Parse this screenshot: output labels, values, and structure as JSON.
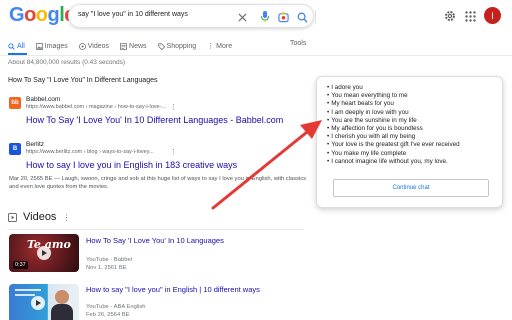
{
  "header": {
    "logo_letters": [
      {
        "char": "G",
        "color": "#4285F4"
      },
      {
        "char": "o",
        "color": "#EA4335"
      },
      {
        "char": "o",
        "color": "#FBBC05"
      },
      {
        "char": "g",
        "color": "#4285F4"
      },
      {
        "char": "l",
        "color": "#34A853"
      },
      {
        "char": "e",
        "color": "#EA4335"
      }
    ],
    "search_value": "say \"I love you\" in 10 different ways",
    "avatar_letter": "I",
    "icons": [
      "close-icon",
      "mic-icon",
      "lens-icon",
      "search-icon",
      "settings-icon",
      "apps-icon"
    ]
  },
  "tabs": [
    {
      "label": "All",
      "icon": "search-icon"
    },
    {
      "label": "Images",
      "icon": "image-icon"
    },
    {
      "label": "Videos",
      "icon": "video-icon"
    },
    {
      "label": "News",
      "icon": "news-icon"
    },
    {
      "label": "Shopping",
      "icon": "tag-icon"
    },
    {
      "label": "More",
      "icon": "more-icon"
    }
  ],
  "tools_label": "Tools",
  "stats": "About 84,800,000 results (0.43 seconds)",
  "question": "How To Say \"I Love You\" In Different Languages",
  "results": [
    {
      "favicon_text": "bb",
      "favicon_color": "#f26522",
      "site": "Babbel.com",
      "url": "https://www.babbel.com › magazine › how-to-say-i-love-...",
      "title": "How To Say 'I Love You' In 10 Different Languages - Babbel.com",
      "snippet": ""
    },
    {
      "favicon_text": "B",
      "favicon_color": "#1a56db",
      "site": "Berlitz",
      "url": "https://www.berlitz.com › blog › ways-to-say-i-lovey...",
      "title": "How to say I love you in English in 183 creative ways",
      "snippet": "Mar 20, 2565 BE — Laugh, swoon, cringe and sob at this huge list of ways to say I love you in English, with classics and even love quotes from the movies."
    }
  ],
  "videos": {
    "heading": "Videos",
    "items": [
      {
        "title": "How To Say 'I Love You' In 10 Languages",
        "source": "YouTube · Babbel",
        "date": "Nov 1, 2561 BE",
        "duration": "0:37",
        "thumb_text": "Te amo"
      },
      {
        "title": "How to say \"I love you\" in English | 10 different ways",
        "source": "YouTube · ABA English",
        "date": "Feb 26, 2564 BE",
        "duration": "",
        "thumb_text": ""
      }
    ]
  },
  "popup": {
    "items": [
      "I adore you",
      "You mean everything to me",
      "My heart beats for you",
      "I am deeply in love with you",
      "You are the sunshine in my life",
      "My affection for you is boundless",
      "I cherish you with all my being",
      "Your love is the greatest gift I've ever received",
      "You make my life complete",
      "I cannot imagine life without you, my love."
    ],
    "button_label": "Continue chat"
  },
  "colors": {
    "link": "#1a0dab",
    "accent": "#1a73e8",
    "arrow": "#e53935"
  }
}
